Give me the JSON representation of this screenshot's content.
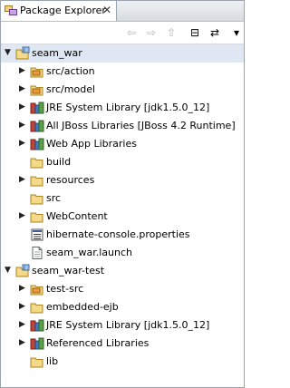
{
  "view": {
    "title": "Package Explorer",
    "close_glyph": "✕",
    "toolbar": [
      {
        "name": "back-icon",
        "glyph": "⇦",
        "enabled": false
      },
      {
        "name": "forward-icon",
        "glyph": "⇨",
        "enabled": false
      },
      {
        "name": "up-icon",
        "glyph": "⇧",
        "enabled": false
      },
      {
        "name": "collapse-all-icon",
        "glyph": "⊟",
        "enabled": true
      },
      {
        "name": "link-with-editor-icon",
        "glyph": "⇄",
        "enabled": true
      },
      {
        "name": "view-menu-icon",
        "glyph": "▾",
        "enabled": true
      }
    ]
  },
  "tree": [
    {
      "label": "seam_war",
      "depth": 0,
      "twisty": "expanded",
      "icon": "project-icon",
      "selected": true
    },
    {
      "label": "src/action",
      "depth": 1,
      "twisty": "collapsed",
      "icon": "source-folder-icon"
    },
    {
      "label": "src/model",
      "depth": 1,
      "twisty": "collapsed",
      "icon": "source-folder-icon"
    },
    {
      "label": "JRE System Library [jdk1.5.0_12]",
      "depth": 1,
      "twisty": "collapsed",
      "icon": "library-icon"
    },
    {
      "label": "All JBoss Libraries [JBoss 4.2 Runtime]",
      "depth": 1,
      "twisty": "collapsed",
      "icon": "library-icon"
    },
    {
      "label": "Web App Libraries",
      "depth": 1,
      "twisty": "collapsed",
      "icon": "library-icon"
    },
    {
      "label": "build",
      "depth": 1,
      "twisty": "none",
      "icon": "folder-icon"
    },
    {
      "label": "resources",
      "depth": 1,
      "twisty": "collapsed",
      "icon": "folder-icon"
    },
    {
      "label": "src",
      "depth": 1,
      "twisty": "none",
      "icon": "folder-icon"
    },
    {
      "label": "WebContent",
      "depth": 1,
      "twisty": "collapsed",
      "icon": "folder-icon"
    },
    {
      "label": "hibernate-console.properties",
      "depth": 1,
      "twisty": "none",
      "icon": "properties-file-icon"
    },
    {
      "label": "seam_war.launch",
      "depth": 1,
      "twisty": "none",
      "icon": "file-icon"
    },
    {
      "label": "seam_war-test",
      "depth": 0,
      "twisty": "expanded",
      "icon": "project-icon"
    },
    {
      "label": "test-src",
      "depth": 1,
      "twisty": "collapsed",
      "icon": "source-folder-icon"
    },
    {
      "label": "embedded-ejb",
      "depth": 1,
      "twisty": "collapsed",
      "icon": "folder-icon"
    },
    {
      "label": "JRE System Library [jdk1.5.0_12]",
      "depth": 1,
      "twisty": "collapsed",
      "icon": "library-icon"
    },
    {
      "label": "Referenced Libraries",
      "depth": 1,
      "twisty": "collapsed",
      "icon": "library-icon"
    },
    {
      "label": "lib",
      "depth": 1,
      "twisty": "none",
      "icon": "folder-icon"
    }
  ]
}
